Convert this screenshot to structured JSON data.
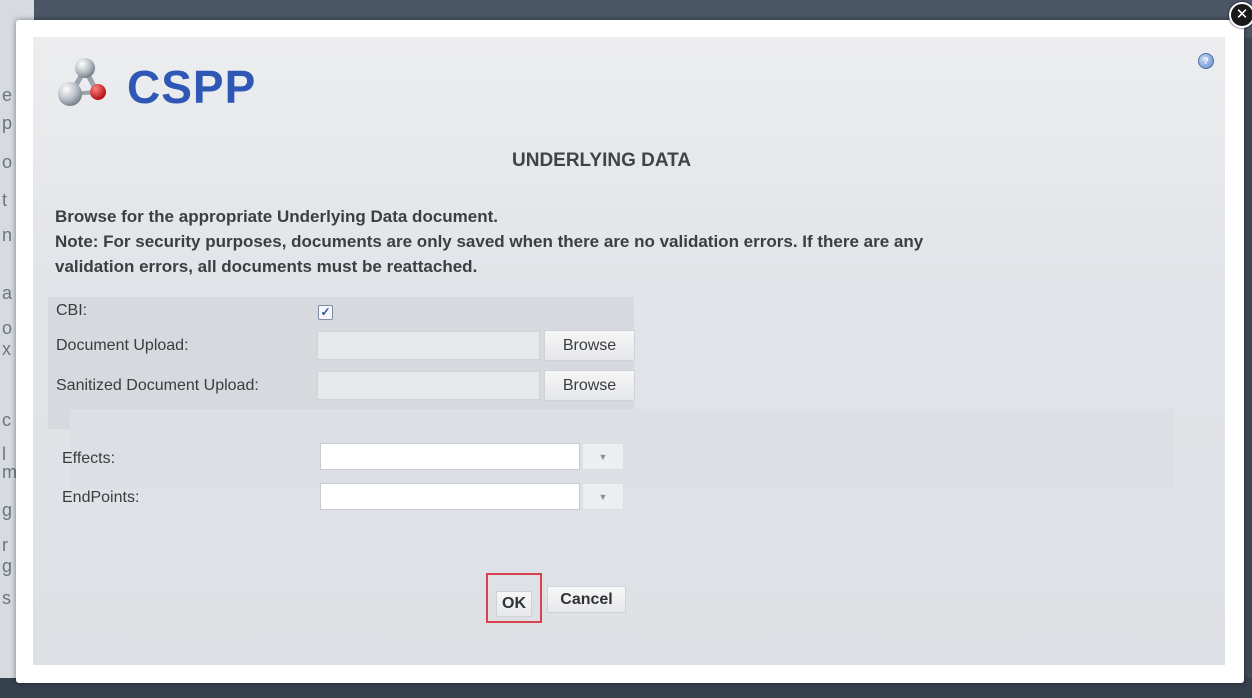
{
  "app": {
    "logo_text": "CSPP",
    "brand_color": "#2f57b6"
  },
  "dialog": {
    "title": "UNDERLYING DATA",
    "instructions": [
      "Browse for the appropriate Underlying Data document.",
      "Note: For security purposes, documents are only saved when there are no validation errors. If there are any",
      "validation errors, all documents must be reattached."
    ],
    "icons": {
      "help": "help-icon",
      "close": "close-icon"
    }
  },
  "form": {
    "cbi": {
      "label": "CBI:",
      "checked": true,
      "check_glyph": "✓"
    },
    "document_upload": {
      "label": "Document Upload:",
      "button": "Browse",
      "value": ""
    },
    "sanitized_upload": {
      "label": "Sanitized Document Upload:",
      "button": "Browse",
      "value": ""
    },
    "effects": {
      "label": "Effects:",
      "value": ""
    },
    "endpoints": {
      "label": "EndPoints:",
      "value": ""
    }
  },
  "actions": {
    "ok": "OK",
    "cancel": "Cancel",
    "ok_highlight_color": "#d9434f"
  },
  "background": {
    "side_letters": [
      "e",
      "p",
      "o",
      "t",
      "n",
      "a",
      "o",
      "x",
      "c",
      "l",
      "m",
      "g",
      "r",
      "g",
      "s"
    ]
  }
}
